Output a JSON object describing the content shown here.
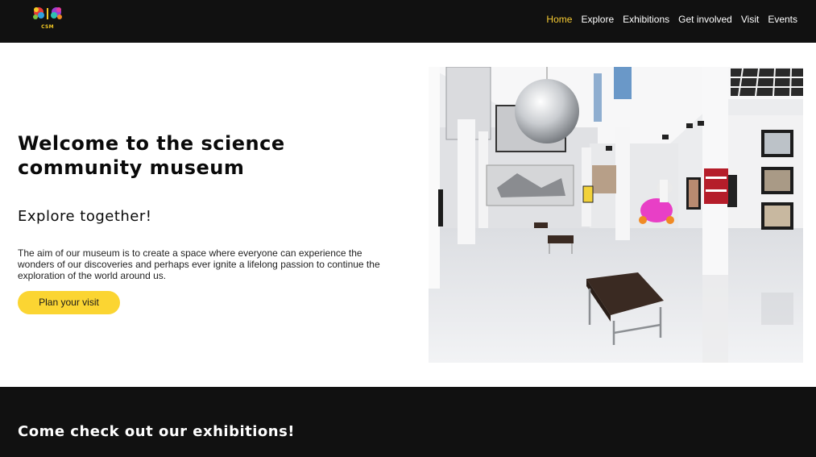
{
  "header": {
    "logo_text": "CSM",
    "nav": [
      {
        "label": "Home",
        "active": true
      },
      {
        "label": "Explore",
        "active": false
      },
      {
        "label": "Exhibitions",
        "active": false
      },
      {
        "label": "Get involved",
        "active": false
      },
      {
        "label": "Visit",
        "active": false
      },
      {
        "label": "Events",
        "active": false
      }
    ]
  },
  "hero": {
    "title": "Welcome to the science community museum",
    "subtitle": "Explore together!",
    "body": "The aim of our museum is to create a space where everyone can experience the wonders of our discoveries and perhaps ever ignite a lifelong passion to continue the exploration of the world around us.",
    "cta_label": "Plan your visit",
    "image_icon": "museum-gallery-photo"
  },
  "exhibitions": {
    "heading": "Come check out our exhibitions!"
  },
  "colors": {
    "accent": "#fbd532",
    "nav_active": "#f7cb33",
    "dark_bg": "#111111"
  }
}
